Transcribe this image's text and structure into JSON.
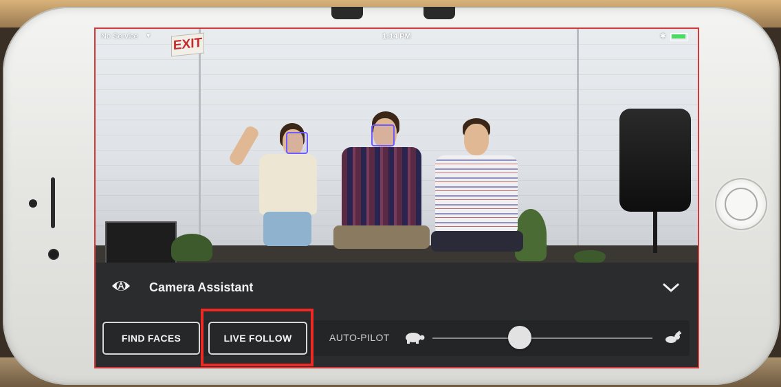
{
  "status_bar": {
    "carrier": "No Service",
    "time": "1:14 PM"
  },
  "scene": {
    "exit_sign": "EXIT"
  },
  "panel": {
    "title": "Camera Assistant",
    "buttons": {
      "find_faces": "FIND FACES",
      "live_follow": "LIVE FOLLOW"
    },
    "auto_pilot_label": "AUTO-PILOT",
    "speed_slider": {
      "value_fraction": 0.37
    }
  },
  "colors": {
    "highlight": "#ee2a25",
    "face_box": "#6f5bff",
    "panel_bg": "#2b2c2e"
  },
  "icons": [
    "eye-icon",
    "chevron-down-icon",
    "turtle-icon",
    "rabbit-icon",
    "wifi-icon",
    "bluetooth-icon",
    "battery-icon"
  ]
}
